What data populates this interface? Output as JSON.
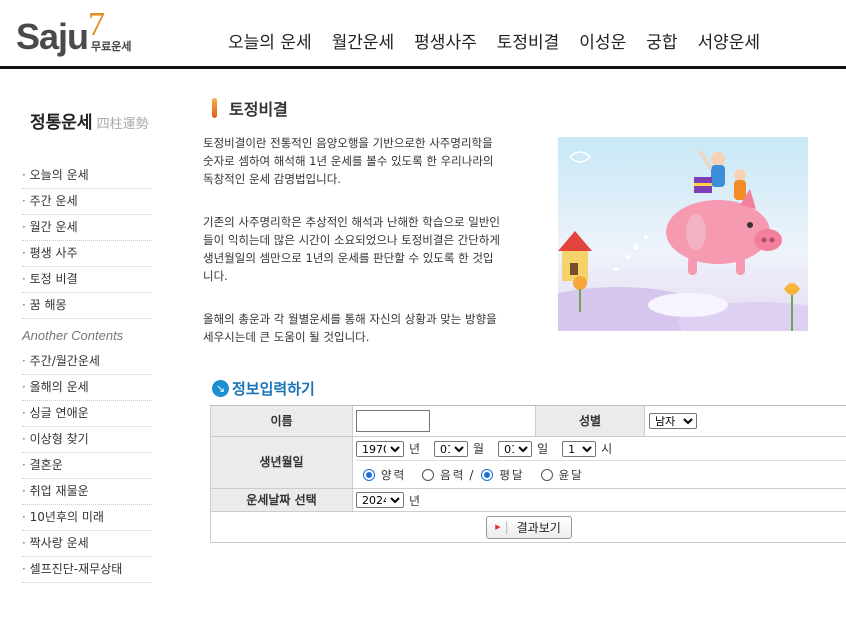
{
  "logo": {
    "text": "Saju",
    "seven": "7",
    "sub": "무료운세"
  },
  "nav": [
    "오늘의 운세",
    "월간운세",
    "평생사주",
    "토정비결",
    "이성운",
    "궁합",
    "서양운세"
  ],
  "sidebar": {
    "title": "정통운세",
    "title_hanja": "四柱運勢",
    "items": [
      "오늘의 운세",
      "주간 운세",
      "월간 운세",
      "평생 사주",
      "토정 비결",
      "꿈 해몽"
    ],
    "another_title": "Another Contents",
    "another_items": [
      "주간/월간운세",
      "올해의 운세",
      "싱글 연애운",
      "이상형 찾기",
      "결혼운",
      "취업 재물운",
      "10년후의 미래",
      "짝사랑 운세",
      "셀프진단-재무상태"
    ]
  },
  "content": {
    "title": "토정비결",
    "paragraphs": [
      "토정비결이란 전통적인 음양오행을 기반으로한 사주명리학을 숫자로 셈하여 해석해 1년 운세를 볼수 있도록 한 우리나라의 독창적인 운세 감명법입니다.",
      "기존의 사주명리학은 추상적인 해석과 난해한 학습으로 일반인들이 익히는데 많은 시간이 소요되었으나 토정비결은 간단하게 생년월일의 셈만으로 1년의 운세를 판단할 수 있도록 한 것입니다.",
      "올해의 총운과 각 월별운세를 통해 자신의 상황과 맞는 방향을 세우시는데 큰 도움이 될 것입니다."
    ]
  },
  "form": {
    "title": "정보입력하기",
    "name_label": "이름",
    "name_value": "",
    "gender_label": "성별",
    "gender_value": "남자",
    "birth_label": "생년월일",
    "year_value": "1970",
    "year_unit": "년",
    "month_value": "01",
    "month_unit": "월",
    "day_value": "01",
    "day_unit": "일",
    "hour_value": "1",
    "hour_unit": "시",
    "calendar_solar": "양력",
    "calendar_lunar": "음력",
    "calendar_sep": "/",
    "leap_normal": "평달",
    "leap_yun": "윤달",
    "fortune_year_label": "운세날짜 선택",
    "fortune_year_value": "2024",
    "fortune_year_unit": "년",
    "submit_label": "결과보기"
  },
  "colors": {
    "accent": "#1a73b8",
    "logo_seven": "#e08a1e",
    "label_bg": "#ebebeb"
  }
}
